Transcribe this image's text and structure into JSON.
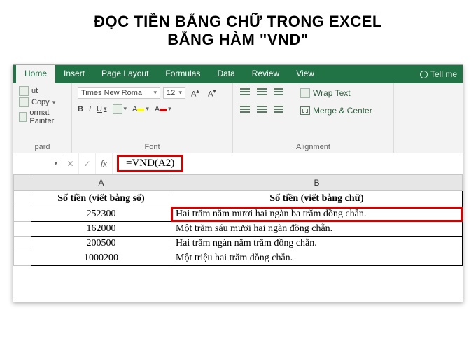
{
  "title_line1": "ĐỌC TIỀN BẰNG CHỮ TRONG EXCEL",
  "title_line2": "BẰNG HÀM \"VND\"",
  "tabs": [
    "Home",
    "Insert",
    "Page Layout",
    "Formulas",
    "Data",
    "Review",
    "View"
  ],
  "tellme": "Tell me",
  "clipboard": {
    "cut": "ut",
    "copy": "Copy",
    "painter": "ormat Painter",
    "group": "pard"
  },
  "font": {
    "name": "Times New Roma",
    "size": "12",
    "growA": "A˄",
    "shrinkA": "A˅",
    "b": "B",
    "i": "I",
    "u": "U",
    "fillA": "A",
    "colorA": "A",
    "group": "Font"
  },
  "align": {
    "wrap": "Wrap Text",
    "merge": "Merge & Center",
    "group": "Alignment"
  },
  "formula": "=VND(A2)",
  "fx": "fx",
  "cancel": "✕",
  "accept": "✓",
  "nbcaret": "▾",
  "colA": "A",
  "colB": "B",
  "header_a": "Số tiền (viết bằng số)",
  "header_b": "Số tiền (viết bằng chữ)",
  "rows": [
    {
      "num": "252300",
      "text": "Hai trăm năm mươi hai ngàn ba trăm đồng chẵn."
    },
    {
      "num": "162000",
      "text": "Một trăm sáu mươi hai ngàn đồng chẵn."
    },
    {
      "num": "200500",
      "text": "Hai trăm ngàn năm trăm đồng chẵn."
    },
    {
      "num": "1000200",
      "text": "Một triệu hai trăm đồng chẵn."
    }
  ],
  "chart_data": {
    "type": "table",
    "columns": [
      "Số tiền (viết bằng số)",
      "Số tiền (viết bằng chữ)"
    ],
    "rows": [
      [
        "252300",
        "Hai trăm năm mươi hai ngàn ba trăm đồng chẵn."
      ],
      [
        "162000",
        "Một trăm sáu mươi hai ngàn đồng chẵn."
      ],
      [
        "200500",
        "Hai trăm ngàn năm trăm đồng chẵn."
      ],
      [
        "1000200",
        "Một triệu hai trăm đồng chẵn."
      ]
    ],
    "formula": "=VND(A2)"
  }
}
